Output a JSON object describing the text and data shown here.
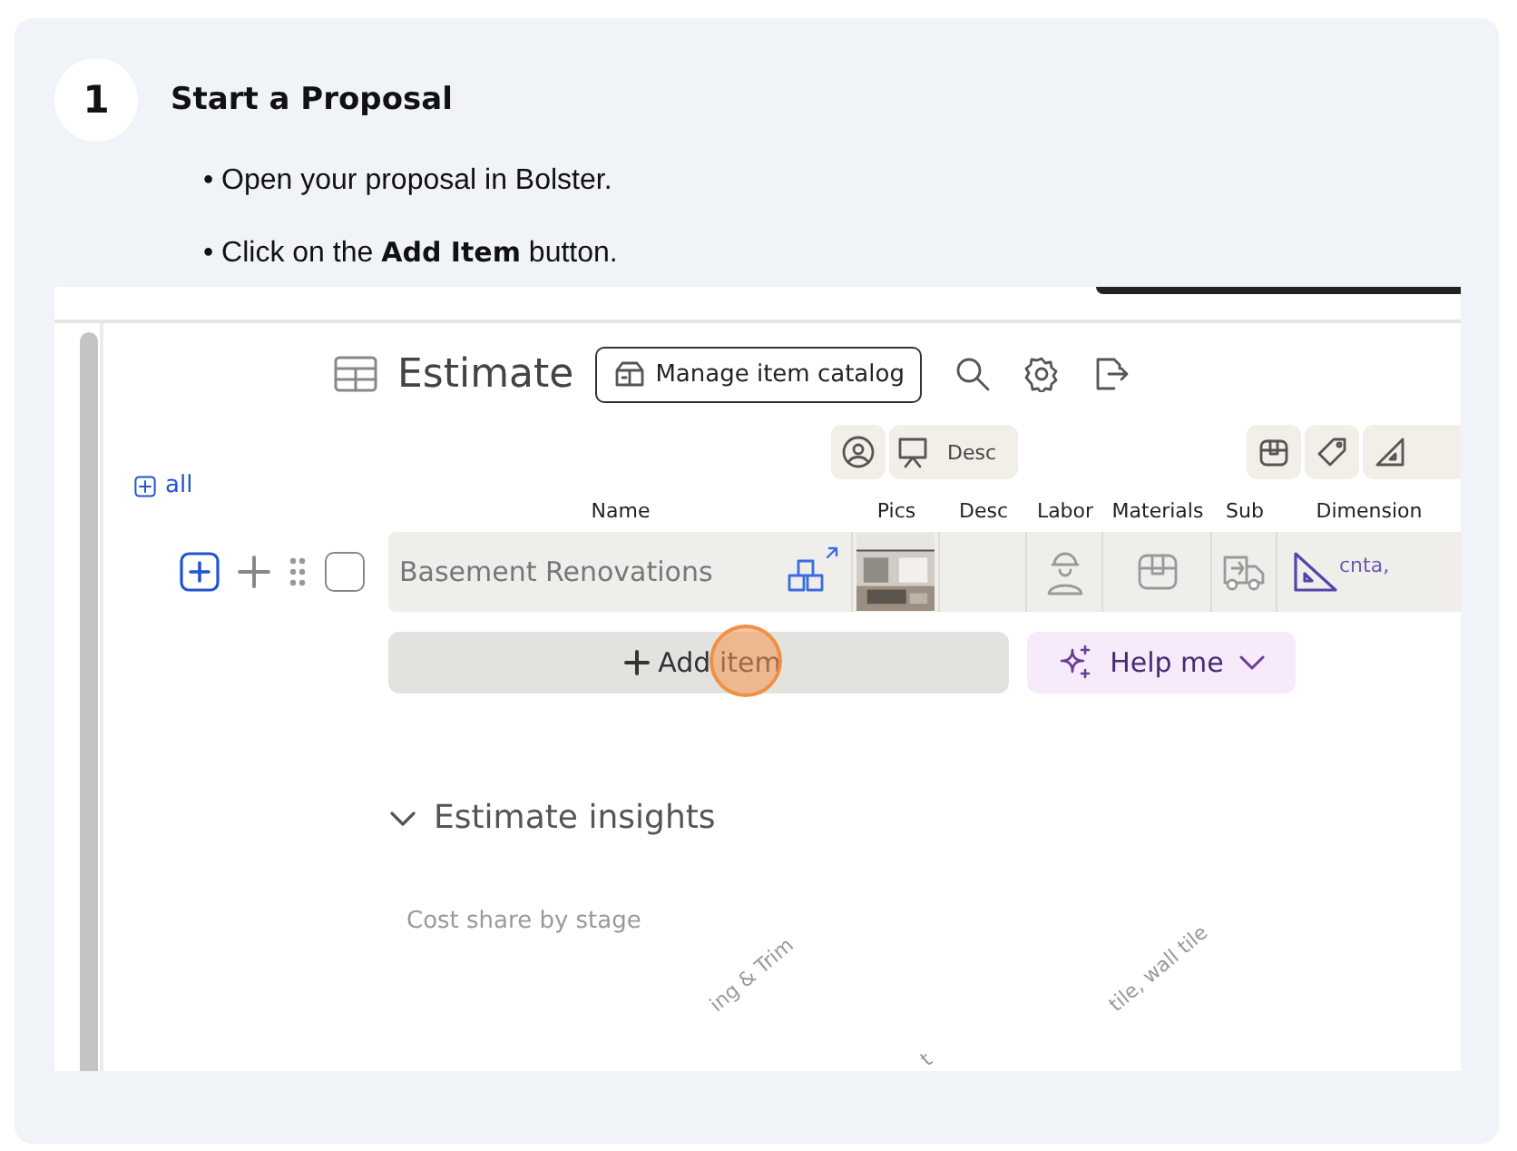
{
  "step": {
    "number": "1",
    "title": "Start a Proposal"
  },
  "instructions": [
    "• Open your proposal in Bolster.",
    "• Click on the **Add Item** button."
  ],
  "estimate": {
    "title": "Estimate",
    "catalog_button": "Manage item catalog",
    "chip_label": "Desc",
    "expand_all": "all",
    "columns": [
      "Name",
      "Pics",
      "Desc",
      "Labor",
      "Materials",
      "Sub",
      "Dimension"
    ],
    "rows": [
      {
        "name": "Basement Renovations",
        "checked": false,
        "dimension": "cnta,"
      }
    ],
    "add_item_button": "Add item",
    "help_button": "Help me",
    "insights": {
      "title": "Estimate insights",
      "expanded": true,
      "chart_title": "Cost share by stage",
      "axis_labels": [
        "ing & Trim",
        "t",
        "tile, wall tile"
      ]
    }
  }
}
